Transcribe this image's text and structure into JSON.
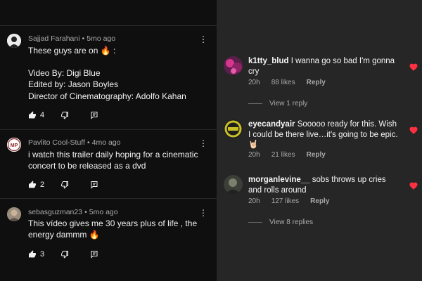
{
  "youtube": {
    "comments": [
      {
        "author": "Sajjad Farahani",
        "time": "5mo ago",
        "lines": [
          "These guys are on 🔥 :",
          "",
          "Video By: Digi Blue",
          "Edited by: Jason Boyles",
          "Director of Cinematography: Adolfo Kahan"
        ],
        "likes": "4",
        "avatar_icon": "user-avatar-silhouette"
      },
      {
        "author": "Pavlito Cool-Stuff",
        "time": "4mo ago",
        "lines": [
          "i watch this trailer daily hoping for a cinematic",
          "concert to be released as a dvd"
        ],
        "likes": "2",
        "avatar_icon": "user-avatar-logo"
      },
      {
        "author": "sebasguzman23",
        "time": "5mo ago",
        "lines": [
          "This vídeo gives me 30 years plus of life , the",
          "energy dammm 🔥"
        ],
        "likes": "3",
        "avatar_icon": "user-avatar-photo"
      }
    ],
    "dot": "•",
    "more_icon": "⋮"
  },
  "instagram": {
    "comments": [
      {
        "username": "k1tty_blud",
        "text": "I wanna go so bad I'm gonna cry",
        "time": "20h",
        "likes": "88 likes",
        "reply": "Reply",
        "view_replies": "View 1 reply",
        "avatar_icon": "user-avatar-pink"
      },
      {
        "username": "eyecandyair",
        "text": "Sooooo ready for this. Wish I could be there live…it's going to be epic. 🤘🏻",
        "time": "20h",
        "likes": "21 likes",
        "reply": "Reply",
        "avatar_icon": "user-avatar-badge"
      },
      {
        "username": "morganlevine__",
        "text": "sobs throws up cries and rolls around",
        "time": "20h",
        "likes": "127 likes",
        "reply": "Reply",
        "view_replies": "View 8 replies",
        "avatar_icon": "user-avatar-dark"
      }
    ],
    "heart_color": "#ff3040"
  },
  "colors": {
    "youtube_bg": "#0f0f0f",
    "instagram_bg": "#262626",
    "heart": "#ff3040"
  }
}
